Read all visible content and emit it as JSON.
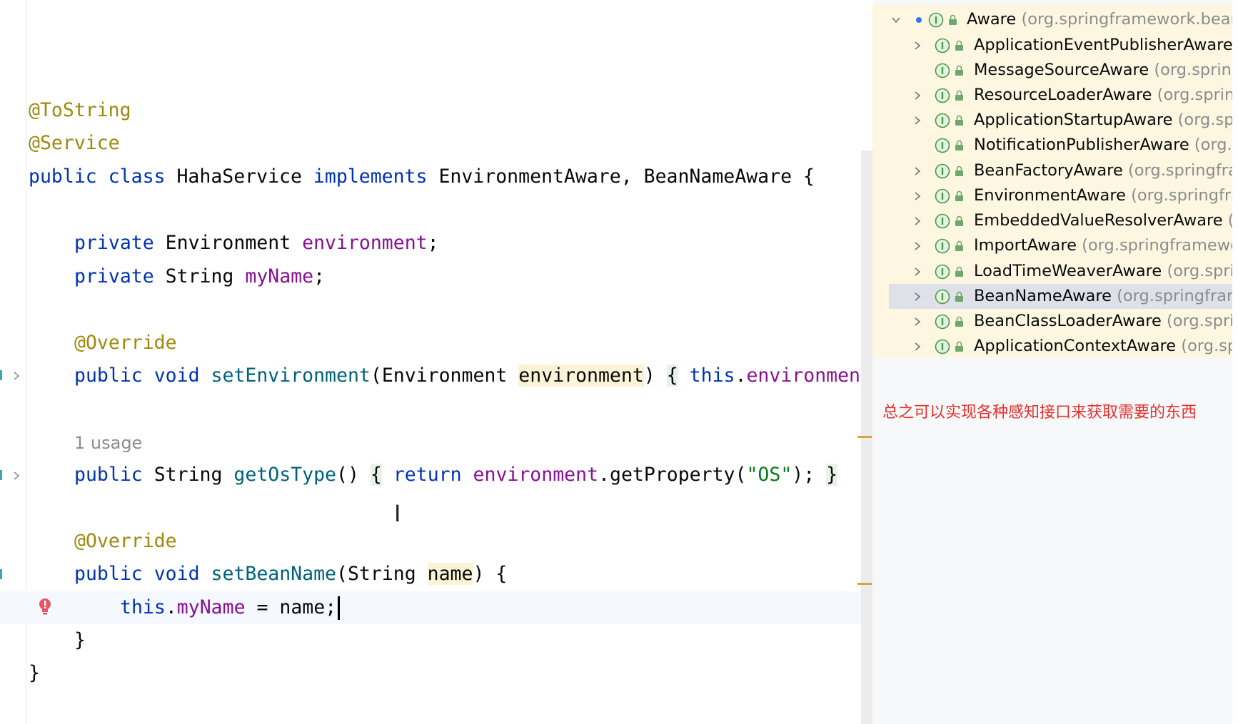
{
  "editor": {
    "lines": {
      "l1": "@ToString",
      "l2": "@Service",
      "l3_kw1": "public",
      "l3_kw2": "class",
      "l3_name": "HahaService",
      "l3_kw3": "implements",
      "l3_rest": "EnvironmentAware, BeanNameAware {",
      "l4_kw": "private",
      "l4_type": "Environment",
      "l4_field": "environment",
      "l5_kw": "private",
      "l5_type": "String",
      "l5_field": "myName",
      "l6": "@Override",
      "l7_kw1": "public",
      "l7_kw2": "void",
      "l7_method": "setEnvironment",
      "l7_type": "(Environment ",
      "l7_param": "environment",
      "l7_close": ")",
      "l7_brace": "{",
      "l7_this": "this",
      "l7_field": "environment",
      "usage": "1 usage",
      "l8_kw1": "public",
      "l8_type": "String",
      "l8_method": "getOsType",
      "l8_parens": "()",
      "l8_brace_open": "{",
      "l8_return": "return",
      "l8_field": "environment",
      "l8_call": ".getProperty(",
      "l8_str": "\"OS\"",
      "l8_end": ");",
      "l8_brace_close": "}",
      "l9": "@Override",
      "l10_kw1": "public",
      "l10_kw2": "void",
      "l10_method": "setBeanName",
      "l10_type": "(String ",
      "l10_param": "name",
      "l10_rest": ") {",
      "l11_this": "this",
      "l11_field": "myName",
      "l11_rest": " = name;",
      "l12": "}",
      "l13": "}"
    }
  },
  "hierarchy": {
    "root": {
      "name": "Aware",
      "pkg": "(org.springframework.bean"
    },
    "items": [
      {
        "name": "ApplicationEventPublisherAware",
        "pkg": "("
      },
      {
        "name": "MessageSourceAware",
        "pkg": "(org.spring"
      },
      {
        "name": "ResourceLoaderAware",
        "pkg": "(org.spring"
      },
      {
        "name": "ApplicationStartupAware",
        "pkg": "(org.spr"
      },
      {
        "name": "NotificationPublisherAware",
        "pkg": "(org.s"
      },
      {
        "name": "BeanFactoryAware",
        "pkg": "(org.springfra"
      },
      {
        "name": "EnvironmentAware",
        "pkg": "(org.springfra"
      },
      {
        "name": "EmbeddedValueResolverAware",
        "pkg": "(c"
      },
      {
        "name": "ImportAware",
        "pkg": "(org.springframewo"
      },
      {
        "name": "LoadTimeWeaverAware",
        "pkg": "(org.sprir"
      },
      {
        "name": "BeanNameAware",
        "pkg": "(org.springfram"
      },
      {
        "name": "BeanClassLoaderAware",
        "pkg": "(org.sprir"
      },
      {
        "name": "ApplicationContextAware",
        "pkg": "(org.spi"
      }
    ]
  },
  "note": "总之可以实现各种感知接口来获取需要的东西",
  "colors": {
    "keyword": "#0033b3",
    "annotation": "#9e880d",
    "field": "#871094",
    "method": "#00627a",
    "string": "#067d17",
    "tree_bg": "#fdf6e1",
    "note": "#e5322d"
  },
  "icons": [
    "chevron-right-icon",
    "chevron-down-icon",
    "interface-icon",
    "lock-icon",
    "bulb-error-icon",
    "text-cursor-icon"
  ]
}
